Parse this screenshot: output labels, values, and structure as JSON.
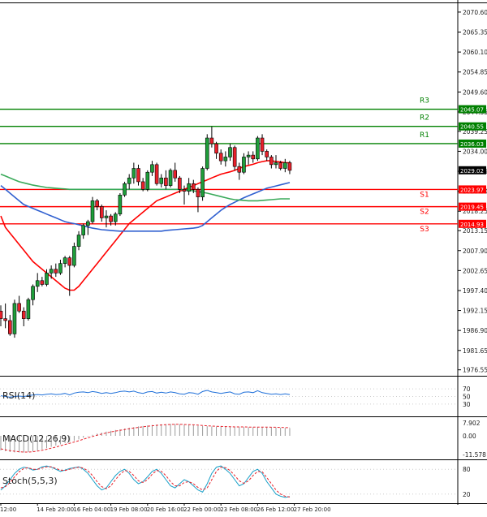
{
  "chart_data": {
    "type": "candlestick",
    "symbol_note": "",
    "price_axis": {
      "ylim": [
        1975.2,
        2072.5
      ],
      "ticks": [
        "2070.60",
        "2065.35",
        "2060.10",
        "2054.85",
        "2049.60",
        "2044.35",
        "2039.25",
        "2034.00",
        "2028.75",
        "2023.50",
        "2018.25",
        "2013.15",
        "2007.90",
        "2002.65",
        "1997.40",
        "1992.15",
        "1986.90",
        "1981.65",
        "1976.55"
      ],
      "tick_values": [
        2070.6,
        2065.35,
        2060.1,
        2054.85,
        2049.6,
        2044.35,
        2039.25,
        2034.0,
        2028.75,
        2023.5,
        2018.25,
        2013.15,
        2007.9,
        2002.65,
        1997.4,
        1992.15,
        1986.9,
        1981.65,
        1976.55
      ]
    },
    "x_axis": {
      "labels": [
        "12:00",
        "14 Feb 20:00",
        "16 Feb 04:00",
        "19 Feb 08:00",
        "20 Feb 16:00",
        "22 Feb 00:00",
        "23 Feb 08:00",
        "26 Feb 12:00",
        "27 Feb 20:00"
      ],
      "label_bar_index": [
        0,
        8,
        16,
        24,
        32,
        40,
        48,
        56,
        64
      ]
    },
    "current_price": "2029.02",
    "levels": [
      {
        "name": "R3",
        "value": 2045.07,
        "label": "2045.07",
        "color": "#008000"
      },
      {
        "name": "R2",
        "value": 2040.55,
        "label": "2040.55",
        "color": "#008000"
      },
      {
        "name": "R1",
        "value": 2036.03,
        "label": "2036.03",
        "color": "#008000"
      },
      {
        "name": "S1",
        "value": 2023.97,
        "label": "2023.97",
        "color": "#ff0000"
      },
      {
        "name": "S2",
        "value": 2019.45,
        "label": "2019.45",
        "color": "#ff0000"
      },
      {
        "name": "S3",
        "value": 2014.93,
        "label": "2014.93",
        "color": "#ff0000"
      }
    ],
    "candles": [
      [
        1992.0,
        1993.5,
        1988.0,
        1990.0
      ],
      [
        1990.0,
        1994.0,
        1987.5,
        1989.5
      ],
      [
        1989.5,
        1991.0,
        1985.5,
        1986.0
      ],
      [
        1986.0,
        1995.0,
        1985.0,
        1994.0
      ],
      [
        1994.0,
        1996.0,
        1991.5,
        1992.0
      ],
      [
        1992.0,
        1993.0,
        1988.0,
        1990.0
      ],
      [
        1990.0,
        1995.5,
        1989.5,
        1995.0
      ],
      [
        1995.0,
        1999.0,
        1993.5,
        1998.5
      ],
      [
        1998.5,
        2002.0,
        1997.0,
        2000.0
      ],
      [
        2000.0,
        2001.0,
        1998.5,
        1999.0
      ],
      [
        1999.0,
        2003.0,
        1998.5,
        2002.0
      ],
      [
        2002.0,
        2004.0,
        2000.5,
        2003.0
      ],
      [
        2003.0,
        2004.5,
        2001.0,
        2002.0
      ],
      [
        2002.0,
        2005.5,
        2001.5,
        2004.5
      ],
      [
        2004.5,
        2006.5,
        2003.5,
        2006.0
      ],
      [
        2006.0,
        2006.5,
        1996.0,
        2004.0
      ],
      [
        2004.0,
        2010.0,
        2003.5,
        2009.0
      ],
      [
        2009.0,
        2013.0,
        2008.0,
        2012.0
      ],
      [
        2012.0,
        2015.0,
        2011.0,
        2014.5
      ],
      [
        2014.5,
        2016.0,
        2012.0,
        2015.5
      ],
      [
        2015.5,
        2022.0,
        2015.0,
        2021.0
      ],
      [
        2021.0,
        2021.5,
        2018.5,
        2019.5
      ],
      [
        2019.5,
        2020.0,
        2015.5,
        2016.5
      ],
      [
        2016.5,
        2018.5,
        2014.0,
        2017.0
      ],
      [
        2017.0,
        2017.5,
        2014.5,
        2015.5
      ],
      [
        2015.5,
        2018.0,
        2014.5,
        2017.5
      ],
      [
        2017.5,
        2023.0,
        2017.0,
        2022.5
      ],
      [
        2022.5,
        2026.0,
        2022.0,
        2025.5
      ],
      [
        2025.5,
        2028.0,
        2024.0,
        2027.0
      ],
      [
        2027.0,
        2031.0,
        2025.5,
        2029.5
      ],
      [
        2029.5,
        2030.5,
        2025.0,
        2026.0
      ],
      [
        2026.0,
        2027.0,
        2023.5,
        2024.0
      ],
      [
        2024.0,
        2029.0,
        2023.5,
        2028.5
      ],
      [
        2028.5,
        2031.5,
        2027.5,
        2030.5
      ],
      [
        2030.5,
        2031.0,
        2025.0,
        2025.5
      ],
      [
        2025.5,
        2028.0,
        2024.5,
        2027.0
      ],
      [
        2027.0,
        2029.0,
        2024.0,
        2025.0
      ],
      [
        2025.0,
        2029.5,
        2024.5,
        2029.0
      ],
      [
        2029.0,
        2031.0,
        2026.0,
        2027.0
      ],
      [
        2027.0,
        2027.5,
        2023.0,
        2024.0
      ],
      [
        2024.0,
        2025.0,
        2020.0,
        2023.5
      ],
      [
        2023.5,
        2027.0,
        2022.5,
        2025.5
      ],
      [
        2025.5,
        2026.5,
        2023.0,
        2024.0
      ],
      [
        2024.0,
        2024.5,
        2018.0,
        2022.0
      ],
      [
        2022.0,
        2030.0,
        2021.0,
        2029.5
      ],
      [
        2029.5,
        2038.5,
        2029.0,
        2037.5
      ],
      [
        2037.5,
        2040.5,
        2035.0,
        2036.0
      ],
      [
        2036.0,
        2036.5,
        2032.0,
        2033.5
      ],
      [
        2033.5,
        2034.5,
        2030.5,
        2031.5
      ],
      [
        2031.5,
        2034.0,
        2030.0,
        2032.5
      ],
      [
        2032.5,
        2036.0,
        2031.5,
        2035.0
      ],
      [
        2035.0,
        2035.5,
        2029.0,
        2030.0
      ],
      [
        2030.0,
        2031.0,
        2026.5,
        2028.5
      ],
      [
        2028.5,
        2033.5,
        2028.0,
        2032.5
      ],
      [
        2032.5,
        2034.0,
        2030.5,
        2033.0
      ],
      [
        2033.0,
        2034.0,
        2031.0,
        2032.0
      ],
      [
        2032.0,
        2038.0,
        2031.5,
        2037.5
      ],
      [
        2037.5,
        2038.5,
        2033.0,
        2034.0
      ],
      [
        2034.0,
        2034.5,
        2031.5,
        2032.5
      ],
      [
        2032.5,
        2033.0,
        2029.5,
        2030.5
      ],
      [
        2030.5,
        2033.0,
        2029.5,
        2031.0
      ],
      [
        2031.0,
        2031.5,
        2029.0,
        2029.5
      ],
      [
        2029.5,
        2032.0,
        2028.5,
        2031.0
      ],
      [
        2031.0,
        2031.5,
        2028.0,
        2029.0
      ]
    ],
    "ma_series": [
      {
        "color": "#ff0000",
        "values": [
          2017.0,
          2014.0,
          2012.5,
          2011.0,
          2009.5,
          2008.0,
          2006.5,
          2005.0,
          2004.0,
          2003.0,
          2002.0,
          2001.0,
          2000.0,
          1999.0,
          1998.0,
          1997.5,
          1997.5,
          1998.5,
          2000.0,
          2001.5,
          2003.0,
          2004.5,
          2006.0,
          2007.5,
          2009.0,
          2010.5,
          2012.0,
          2013.5,
          2015.0,
          2016.0,
          2017.0,
          2018.0,
          2019.0,
          2020.0,
          2021.0,
          2021.5,
          2022.0,
          2022.5,
          2023.0,
          2023.5,
          2024.0,
          2024.5,
          2025.0,
          2025.5,
          2026.0,
          2026.5,
          2027.0,
          2027.5,
          2028.0,
          2028.3,
          2028.6,
          2029.0,
          2029.5,
          2030.0,
          2030.3,
          2030.6,
          2031.0,
          2031.3,
          2031.5,
          2031.5,
          2031.3,
          2031.2,
          2031.0,
          2031.0
        ]
      },
      {
        "color": "#3060d0",
        "values": [
          2025.0,
          2024.0,
          2023.0,
          2022.0,
          2021.0,
          2020.0,
          2019.5,
          2019.0,
          2018.5,
          2018.0,
          2017.5,
          2017.0,
          2016.5,
          2016.0,
          2015.5,
          2015.2,
          2015.0,
          2014.7,
          2014.4,
          2014.1,
          2013.8,
          2013.6,
          2013.4,
          2013.3,
          2013.2,
          2013.1,
          2013.0,
          2013.0,
          2013.0,
          2013.0,
          2013.0,
          2013.0,
          2013.0,
          2013.0,
          2013.0,
          2013.0,
          2013.2,
          2013.3,
          2013.4,
          2013.5,
          2013.6,
          2013.7,
          2013.8,
          2014.0,
          2014.5,
          2015.5,
          2016.5,
          2017.5,
          2018.5,
          2019.3,
          2020.0,
          2020.6,
          2021.2,
          2021.8,
          2022.3,
          2022.8,
          2023.3,
          2023.8,
          2024.3,
          2024.6,
          2024.9,
          2025.2,
          2025.5,
          2025.8
        ]
      },
      {
        "color": "#3aaa5a",
        "values": [
          2028.0,
          2027.5,
          2027.0,
          2026.5,
          2026.0,
          2025.7,
          2025.4,
          2025.1,
          2024.9,
          2024.7,
          2024.5,
          2024.4,
          2024.3,
          2024.2,
          2024.1,
          2024.0,
          2024.0,
          2024.0,
          2024.0,
          2024.0,
          2024.0,
          2024.0,
          2024.0,
          2024.0,
          2024.0,
          2024.0,
          2024.0,
          2024.0,
          2024.0,
          2024.0,
          2024.0,
          2024.0,
          2024.0,
          2024.0,
          2024.0,
          2024.0,
          2024.0,
          2024.0,
          2024.0,
          2024.0,
          2023.9,
          2023.8,
          2023.6,
          2023.4,
          2023.2,
          2023.0,
          2022.7,
          2022.4,
          2022.1,
          2021.8,
          2021.5,
          2021.3,
          2021.2,
          2021.1,
          2021.0,
          2021.0,
          2021.0,
          2021.1,
          2021.2,
          2021.3,
          2021.4,
          2021.5,
          2021.5,
          2021.5
        ]
      }
    ],
    "rsi": {
      "label": "RSI(14)",
      "ticks": [
        "70",
        "50",
        "30"
      ],
      "tick_values": [
        70,
        50,
        30
      ],
      "ylim": [
        0,
        100
      ],
      "values": [
        52,
        50,
        48,
        50,
        51,
        50,
        52,
        54,
        55,
        54,
        56,
        57,
        55,
        56,
        58,
        54,
        59,
        61,
        62,
        60,
        63,
        61,
        58,
        60,
        58,
        60,
        63,
        64,
        62,
        64,
        60,
        58,
        62,
        63,
        59,
        61,
        59,
        62,
        60,
        57,
        56,
        60,
        59,
        56,
        63,
        66,
        62,
        60,
        58,
        60,
        62,
        57,
        56,
        61,
        62,
        60,
        65,
        60,
        58,
        56,
        57,
        55,
        57,
        55
      ]
    },
    "macd": {
      "label": "MACD(12,26,9)",
      "ticks": [
        "7.902",
        "0.00",
        "-11.578"
      ],
      "tick_values": [
        7.902,
        0,
        -11.578
      ],
      "ylim": [
        -14,
        11
      ],
      "hist": [
        -9,
        -9.5,
        -10,
        -10.2,
        -10.3,
        -10.2,
        -10.0,
        -9.6,
        -9.0,
        -8.3,
        -7.6,
        -6.8,
        -6.0,
        -5.2,
        -4.4,
        -3.8,
        -3.0,
        -2.2,
        -1.2,
        -0.3,
        0.6,
        1.4,
        2.0,
        2.6,
        3.1,
        3.6,
        4.0,
        4.5,
        5.0,
        5.4,
        5.8,
        6.1,
        6.4,
        6.7,
        6.9,
        7.1,
        7.2,
        7.3,
        7.3,
        7.2,
        7.0,
        6.8,
        6.5,
        6.2,
        6.0,
        5.9,
        5.8,
        5.7,
        5.6,
        5.5,
        5.4,
        5.4,
        5.4,
        5.4,
        5.3,
        5.3,
        5.4,
        5.4,
        5.3,
        5.2,
        5.1,
        5.0,
        4.9,
        4.8
      ],
      "signal": [
        -8,
        -8.6,
        -9.1,
        -9.5,
        -9.8,
        -10.0,
        -10.0,
        -9.8,
        -9.4,
        -8.9,
        -8.3,
        -7.6,
        -6.9,
        -6.1,
        -5.3,
        -4.6,
        -3.8,
        -3.0,
        -2.1,
        -1.2,
        -0.4,
        0.4,
        1.1,
        1.8,
        2.4,
        2.9,
        3.4,
        3.9,
        4.4,
        4.8,
        5.2,
        5.6,
        5.9,
        6.2,
        6.5,
        6.7,
        6.9,
        7.0,
        7.1,
        7.1,
        7.0,
        6.9,
        6.8,
        6.6,
        6.4,
        6.2,
        6.0,
        5.9,
        5.8,
        5.7,
        5.6,
        5.5,
        5.5,
        5.5,
        5.4,
        5.4,
        5.4,
        5.4,
        5.4,
        5.3,
        5.3,
        5.2,
        5.1,
        5.0
      ]
    },
    "stoch": {
      "label": "Stoch(5,5,3)",
      "ticks": [
        "80",
        "20"
      ],
      "tick_values": [
        80,
        20
      ],
      "ylim": [
        0,
        100
      ],
      "k": [
        30,
        40,
        55,
        70,
        80,
        85,
        83,
        78,
        80,
        86,
        88,
        85,
        80,
        75,
        78,
        82,
        84,
        86,
        80,
        70,
        55,
        40,
        30,
        35,
        50,
        65,
        75,
        80,
        70,
        55,
        45,
        50,
        62,
        75,
        80,
        70,
        55,
        40,
        35,
        45,
        55,
        50,
        40,
        30,
        25,
        45,
        70,
        85,
        88,
        80,
        70,
        55,
        40,
        45,
        60,
        75,
        80,
        70,
        50,
        35,
        20,
        15,
        12,
        14
      ],
      "d": [
        35,
        38,
        48,
        62,
        74,
        82,
        84,
        80,
        80,
        83,
        86,
        86,
        82,
        78,
        77,
        80,
        83,
        85,
        83,
        76,
        65,
        50,
        38,
        33,
        40,
        55,
        68,
        77,
        75,
        65,
        52,
        48,
        55,
        68,
        77,
        75,
        65,
        50,
        40,
        40,
        48,
        50,
        45,
        36,
        30,
        35,
        55,
        75,
        85,
        84,
        77,
        65,
        52,
        46,
        52,
        65,
        75,
        74,
        60,
        45,
        30,
        20,
        15,
        13
      ]
    }
  }
}
